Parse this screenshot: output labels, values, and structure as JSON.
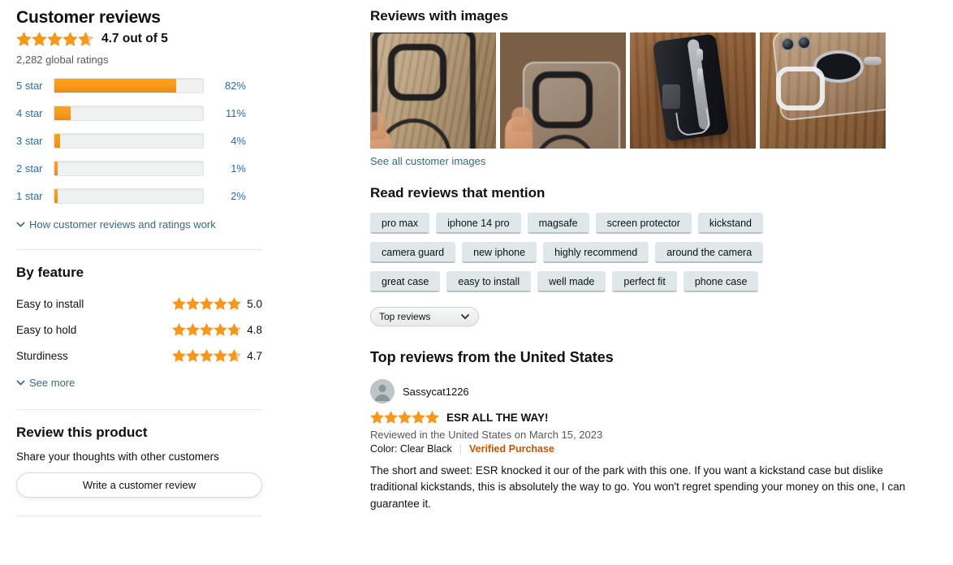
{
  "left": {
    "page_title": "Customer reviews",
    "overall_rating_text": "4.7 out of 5",
    "overall_rating_value": 4.7,
    "global_ratings": "2,282 global ratings",
    "histogram": [
      {
        "label": "5 star",
        "percent_text": "82%",
        "percent": 82
      },
      {
        "label": "4 star",
        "percent_text": "11%",
        "percent": 11
      },
      {
        "label": "3 star",
        "percent_text": "4%",
        "percent": 4
      },
      {
        "label": "2 star",
        "percent_text": "1%",
        "percent": 1
      },
      {
        "label": "1 star",
        "percent_text": "2%",
        "percent": 2
      }
    ],
    "how_reviews_work": "How customer reviews and ratings work",
    "by_feature_title": "By feature",
    "features": [
      {
        "name": "Easy to install",
        "score": "5.0",
        "value": 5.0
      },
      {
        "name": "Easy to hold",
        "score": "4.8",
        "value": 4.8
      },
      {
        "name": "Sturdiness",
        "score": "4.7",
        "value": 4.7
      }
    ],
    "see_more": "See more",
    "review_product_title": "Review this product",
    "review_product_sub": "Share your thoughts with other customers",
    "write_review_button": "Write a customer review"
  },
  "right": {
    "reviews_with_images_title": "Reviews with images",
    "image_count": 4,
    "see_all_images": "See all customer images",
    "read_reviews_title": "Read reviews that mention",
    "tag_rows": [
      [
        "pro max",
        "iphone 14 pro",
        "magsafe",
        "screen protector",
        "kickstand"
      ],
      [
        "camera guard",
        "new iphone",
        "highly recommend",
        "around the camera"
      ],
      [
        "great case",
        "easy to install",
        "well made",
        "perfect fit",
        "phone case"
      ]
    ],
    "sort_selected": "Top reviews",
    "top_reviews_title": "Top reviews from the United States",
    "reviews": [
      {
        "author": "Sassycat1226",
        "rating": 5,
        "title": "ESR ALL THE WAY!",
        "date": "Reviewed in the United States on March 15, 2023",
        "color": "Color: Clear Black",
        "verified": "Verified Purchase",
        "body": "The short and sweet: ESR knocked it our of the park with this one. If you want a kickstand case but dislike traditional kickstands, this is absolutely the way to go. You won't regret spending your money on this one, I can guarantee it."
      }
    ]
  },
  "colors": {
    "star_orange": "#F7981D",
    "star_empty": "#E8D9C3",
    "link_blue": "#2b6ca3",
    "link_slate": "#39687d",
    "verified_orange": "#C45500",
    "tag_bg": "#dfe7e8",
    "track_gray": "#f0f2f2"
  }
}
